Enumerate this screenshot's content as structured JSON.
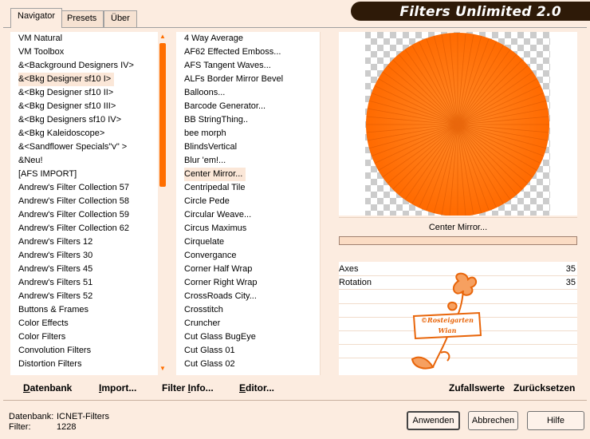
{
  "title": "Filters Unlimited 2.0",
  "tabs": [
    {
      "label": "Navigator",
      "active": true
    },
    {
      "label": "Presets",
      "active": false
    },
    {
      "label": "Über",
      "active": false
    }
  ],
  "categories": [
    {
      "label": "VM Natural"
    },
    {
      "label": "VM Toolbox"
    },
    {
      "label": "&<Background Designers IV>"
    },
    {
      "label": "&<Bkg Designer sf10 I>",
      "selected": true
    },
    {
      "label": "&<Bkg Designer sf10 II>"
    },
    {
      "label": "&<Bkg Designer sf10 III>"
    },
    {
      "label": "&<Bkg Designers sf10 IV>"
    },
    {
      "label": "&<Bkg Kaleidoscope>"
    },
    {
      "label": "&<Sandflower Specials\"v\" >"
    },
    {
      "label": "&Neu!"
    },
    {
      "label": "[AFS IMPORT]"
    },
    {
      "label": "Andrew's Filter Collection 57"
    },
    {
      "label": "Andrew's Filter Collection 58"
    },
    {
      "label": "Andrew's Filter Collection 59"
    },
    {
      "label": "Andrew's Filter Collection 62"
    },
    {
      "label": "Andrew's Filters 12"
    },
    {
      "label": "Andrew's Filters 30"
    },
    {
      "label": "Andrew's Filters 45"
    },
    {
      "label": "Andrew's Filters 51"
    },
    {
      "label": "Andrew's Filters 52"
    },
    {
      "label": "Buttons & Frames"
    },
    {
      "label": "Color Effects"
    },
    {
      "label": "Color Filters"
    },
    {
      "label": "Convolution Filters"
    },
    {
      "label": "Distortion Filters"
    }
  ],
  "filters": [
    {
      "label": "4 Way Average"
    },
    {
      "label": "AF62 Effected Emboss..."
    },
    {
      "label": "AFS Tangent Waves..."
    },
    {
      "label": "ALFs Border Mirror Bevel"
    },
    {
      "label": "Balloons..."
    },
    {
      "label": "Barcode Generator..."
    },
    {
      "label": "BB StringThing.."
    },
    {
      "label": "bee morph"
    },
    {
      "label": "BlindsVertical"
    },
    {
      "label": "Blur 'em!..."
    },
    {
      "label": "Center Mirror...",
      "selected": true
    },
    {
      "label": "Centripedal Tile"
    },
    {
      "label": "Circle Pede"
    },
    {
      "label": "Circular Weave..."
    },
    {
      "label": "Circus Maximus"
    },
    {
      "label": "Cirquelate"
    },
    {
      "label": "Convergance"
    },
    {
      "label": "Corner Half Wrap"
    },
    {
      "label": "Corner Right Wrap"
    },
    {
      "label": "CrossRoads City..."
    },
    {
      "label": "Crosstitch"
    },
    {
      "label": "Cruncher"
    },
    {
      "label": "Cut Glass  BugEye"
    },
    {
      "label": "Cut Glass 01"
    },
    {
      "label": "Cut Glass 02"
    }
  ],
  "preview": {
    "filter_name": "Center Mirror...",
    "accent": "#ff7000",
    "watermark_lines": [
      "©Rosteigarten",
      "Wian"
    ]
  },
  "params": [
    {
      "label": "Axes",
      "value": "35"
    },
    {
      "label": "Rotation",
      "value": "35"
    }
  ],
  "buttons": {
    "datenbank": {
      "first": "D",
      "rest": "atenbank"
    },
    "import": {
      "first": "I",
      "rest": "mport..."
    },
    "filter_info": {
      "pre": "Filter ",
      "u": "I",
      "rest": "nfo..."
    },
    "editor": {
      "first": "E",
      "rest": "ditor..."
    },
    "zufallswerte": "Zufallswerte",
    "zuruecksetzen": "Zurücksetzen",
    "anwenden": "Anwenden",
    "abbrechen": "Abbrechen",
    "hilfe": "Hilfe"
  },
  "status": {
    "datenbank_label": "Datenbank:",
    "datenbank_value": "ICNET-Filters",
    "filter_label": "Filter:",
    "filter_value": "1228"
  },
  "colors": {
    "background": "#fcece0",
    "accent": "#ff6e00",
    "title_bar": "#2e1a08",
    "selection": "#fbe7d8"
  }
}
